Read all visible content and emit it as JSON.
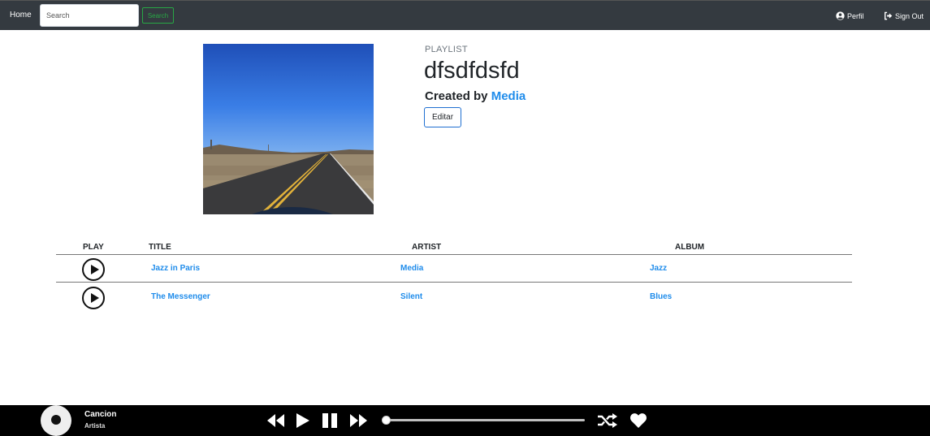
{
  "nav": {
    "home": "Home",
    "search_placeholder": "Search",
    "search_button": "Search",
    "perfil": "Perfil",
    "sign_out": "Sign Out"
  },
  "playlist": {
    "type_label": "PLAYLIST",
    "name": "dfsdfdsfd",
    "created_by_prefix": "Created by",
    "author": "Media",
    "edit_label": "Editar"
  },
  "table": {
    "headers": [
      "PLAY",
      "TITLE",
      "ARTIST",
      "ALBUM"
    ],
    "rows": [
      {
        "title": "Jazz in Paris",
        "artist": "Media",
        "album": "Jazz"
      },
      {
        "title": "The Messenger",
        "artist": "Silent",
        "album": "Blues"
      }
    ]
  },
  "player": {
    "song": "Cancion",
    "artist": "Artista",
    "progress": 0
  },
  "colors": {
    "navbar": "#343a40",
    "link": "#1f8ceb",
    "search_accent": "#28a745",
    "player_bar": "#000000"
  },
  "icons": [
    "user-circle-icon",
    "sign-out-icon",
    "play-circle-icon",
    "rewind-icon",
    "play-icon",
    "pause-icon",
    "fast-forward-icon",
    "shuffle-icon",
    "heart-icon"
  ]
}
